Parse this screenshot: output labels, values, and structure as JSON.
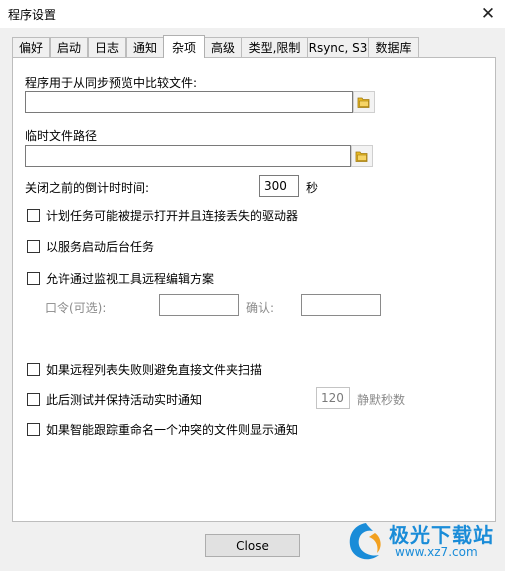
{
  "window": {
    "title": "程序设置",
    "close_glyph": "✕"
  },
  "tabs": [
    {
      "label": "偏好"
    },
    {
      "label": "启动"
    },
    {
      "label": "日志"
    },
    {
      "label": "通知"
    },
    {
      "label": "杂项",
      "active": true
    },
    {
      "label": "高级"
    },
    {
      "label": "类型,限制"
    },
    {
      "label": "Rsync, S3"
    },
    {
      "label": "数据库"
    }
  ],
  "misc": {
    "compare_label": "程序用于从同步预览中比较文件:",
    "compare_value": "",
    "temp_path_label": "临时文件路径",
    "temp_path_value": "",
    "countdown_label": "关闭之前的倒计时时间:",
    "countdown_value": "300",
    "countdown_unit": "秒",
    "cb_scheduled": "计划任务可能被提示打开并且连接丢失的驱动器",
    "cb_service": "以服务启动后台任务",
    "cb_remote_edit": "允许通过监视工具远程编辑方案",
    "password_label": "口令(可选):",
    "password_value": "",
    "confirm_label": "确认:",
    "confirm_value": "",
    "cb_avoid_scan": "如果远程列表失败则避免直接文件夹扫描",
    "cb_keep_notify": "此后测试并保持活动实时通知",
    "silent_value": "120",
    "silent_label": "静默秒数",
    "cb_rename_notify": "如果智能跟踪重命名一个冲突的文件则显示通知",
    "folder_icon": "folder-icon"
  },
  "footer": {
    "close_button": "Close"
  },
  "watermark": {
    "line1": "极光下载站",
    "line2": "www.xz7.com"
  },
  "colors": {
    "accent": "#1a8cd8",
    "folder": "#e8b923"
  }
}
